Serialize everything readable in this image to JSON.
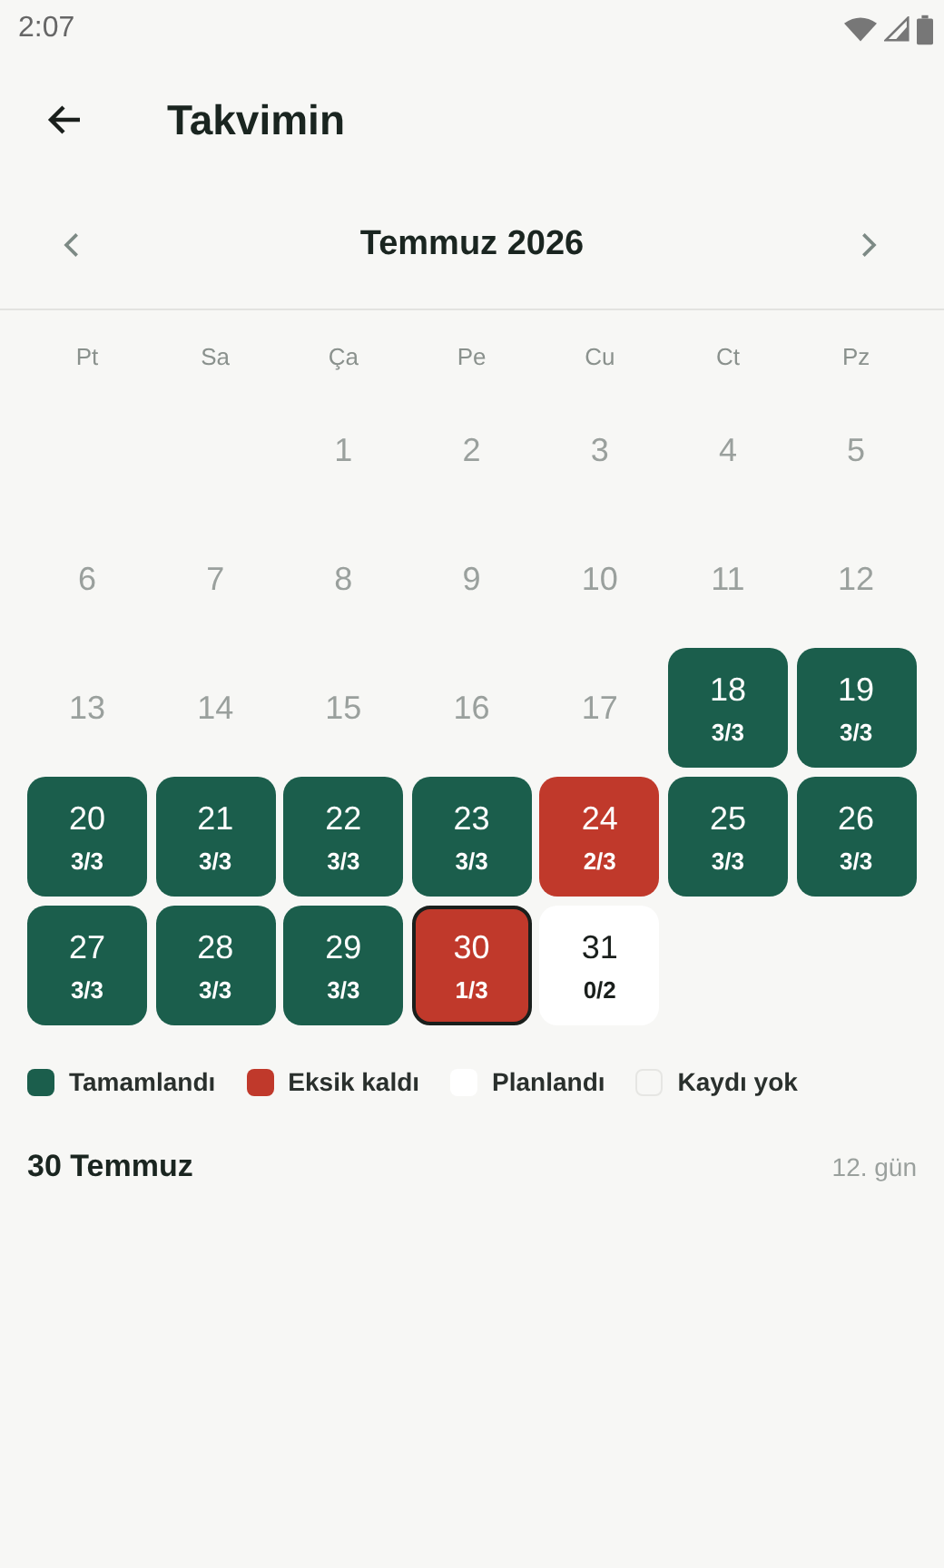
{
  "status_bar": {
    "time": "2:07"
  },
  "app_bar": {
    "title": "Takvimin"
  },
  "month": {
    "title": "Temmuz 2026"
  },
  "weekdays": [
    "Pt",
    "Sa",
    "Ça",
    "Pe",
    "Cu",
    "Ct",
    "Pz"
  ],
  "days": [
    {
      "kind": "blank"
    },
    {
      "kind": "blank"
    },
    {
      "day": "1",
      "kind": "none",
      "selected": false
    },
    {
      "day": "2",
      "kind": "none",
      "selected": false
    },
    {
      "day": "3",
      "kind": "none",
      "selected": false
    },
    {
      "day": "4",
      "kind": "none",
      "selected": false
    },
    {
      "day": "5",
      "kind": "none",
      "selected": false
    },
    {
      "day": "6",
      "kind": "none",
      "selected": false
    },
    {
      "day": "7",
      "kind": "none",
      "selected": false
    },
    {
      "day": "8",
      "kind": "none",
      "selected": false
    },
    {
      "day": "9",
      "kind": "none",
      "selected": false
    },
    {
      "day": "10",
      "kind": "none",
      "selected": false
    },
    {
      "day": "11",
      "kind": "none",
      "selected": false
    },
    {
      "day": "12",
      "kind": "none",
      "selected": false
    },
    {
      "day": "13",
      "kind": "none",
      "selected": false
    },
    {
      "day": "14",
      "kind": "none",
      "selected": false
    },
    {
      "day": "15",
      "kind": "none",
      "selected": false
    },
    {
      "day": "16",
      "kind": "none",
      "selected": false
    },
    {
      "day": "17",
      "kind": "none",
      "selected": false
    },
    {
      "day": "18",
      "kind": "done",
      "count": "3/3",
      "selected": false
    },
    {
      "day": "19",
      "kind": "done",
      "count": "3/3",
      "selected": false
    },
    {
      "day": "20",
      "kind": "done",
      "count": "3/3",
      "selected": false
    },
    {
      "day": "21",
      "kind": "done",
      "count": "3/3",
      "selected": false
    },
    {
      "day": "22",
      "kind": "done",
      "count": "3/3",
      "selected": false
    },
    {
      "day": "23",
      "kind": "done",
      "count": "3/3",
      "selected": false
    },
    {
      "day": "24",
      "kind": "missed",
      "count": "2/3",
      "selected": false
    },
    {
      "day": "25",
      "kind": "done",
      "count": "3/3",
      "selected": false
    },
    {
      "day": "26",
      "kind": "done",
      "count": "3/3",
      "selected": false
    },
    {
      "day": "27",
      "kind": "done",
      "count": "3/3",
      "selected": false
    },
    {
      "day": "28",
      "kind": "done",
      "count": "3/3",
      "selected": false
    },
    {
      "day": "29",
      "kind": "done",
      "count": "3/3",
      "selected": false
    },
    {
      "day": "30",
      "kind": "missed",
      "count": "1/3",
      "selected": true
    },
    {
      "day": "31",
      "kind": "planned",
      "count": "0/2",
      "selected": false
    }
  ],
  "legend": [
    {
      "label": "Tamamlandı",
      "color": "#1b5e4c"
    },
    {
      "label": "Eksik kaldı",
      "color": "#c0392b"
    },
    {
      "label": "Planlandı",
      "color": "#ffffff"
    },
    {
      "label": "Kaydı yok",
      "color": "#f7f7f5"
    }
  ],
  "detail": {
    "date": "30 Temmuz",
    "day_number": "12. gün"
  }
}
